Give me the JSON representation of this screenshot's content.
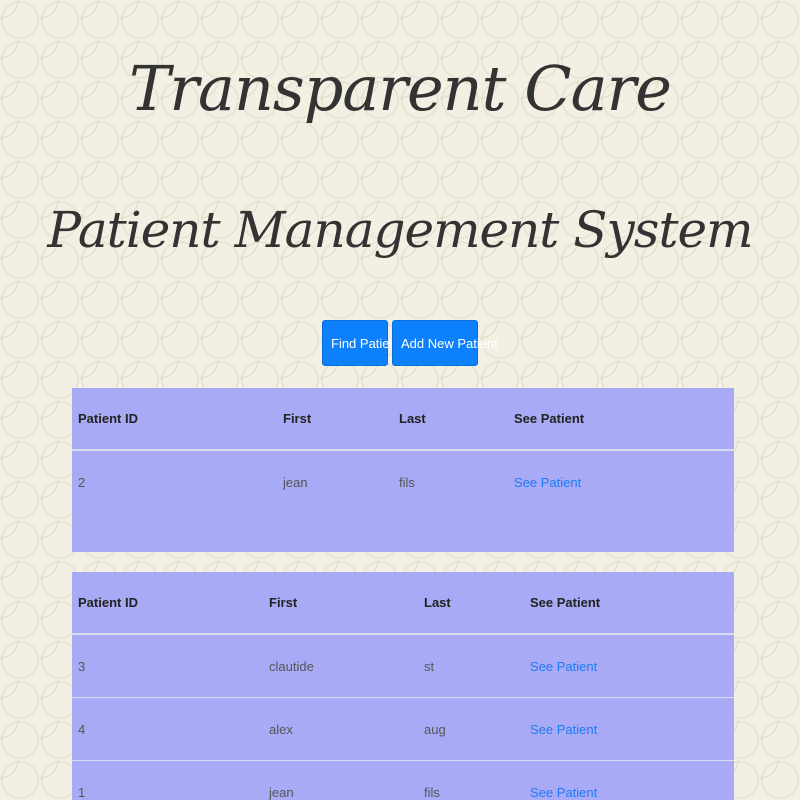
{
  "header": {
    "title": "Transparent Care",
    "subtitle": "Patient Management System"
  },
  "actions": {
    "find_patient": "Find Patient",
    "add_new_patient": "Add New Patient"
  },
  "tables": [
    {
      "columns": [
        "Patient ID",
        "First",
        "Last",
        "See Patient"
      ],
      "rows": [
        {
          "id": "2",
          "first": "jean",
          "last": "fils",
          "link": "See Patient"
        }
      ]
    },
    {
      "columns": [
        "Patient ID",
        "First",
        "Last",
        "See Patient"
      ],
      "rows": [
        {
          "id": "3",
          "first": "clautide",
          "last": "st",
          "link": "See Patient"
        },
        {
          "id": "4",
          "first": "alex",
          "last": "aug",
          "link": "See Patient"
        },
        {
          "id": "1",
          "first": "jean",
          "last": "fils",
          "link": "See Patient"
        }
      ]
    }
  ],
  "colors": {
    "button": "#0d80fb",
    "table_background": "#a8aaf5",
    "link": "#1e7bf5",
    "page_background": "#f3f0e3"
  }
}
